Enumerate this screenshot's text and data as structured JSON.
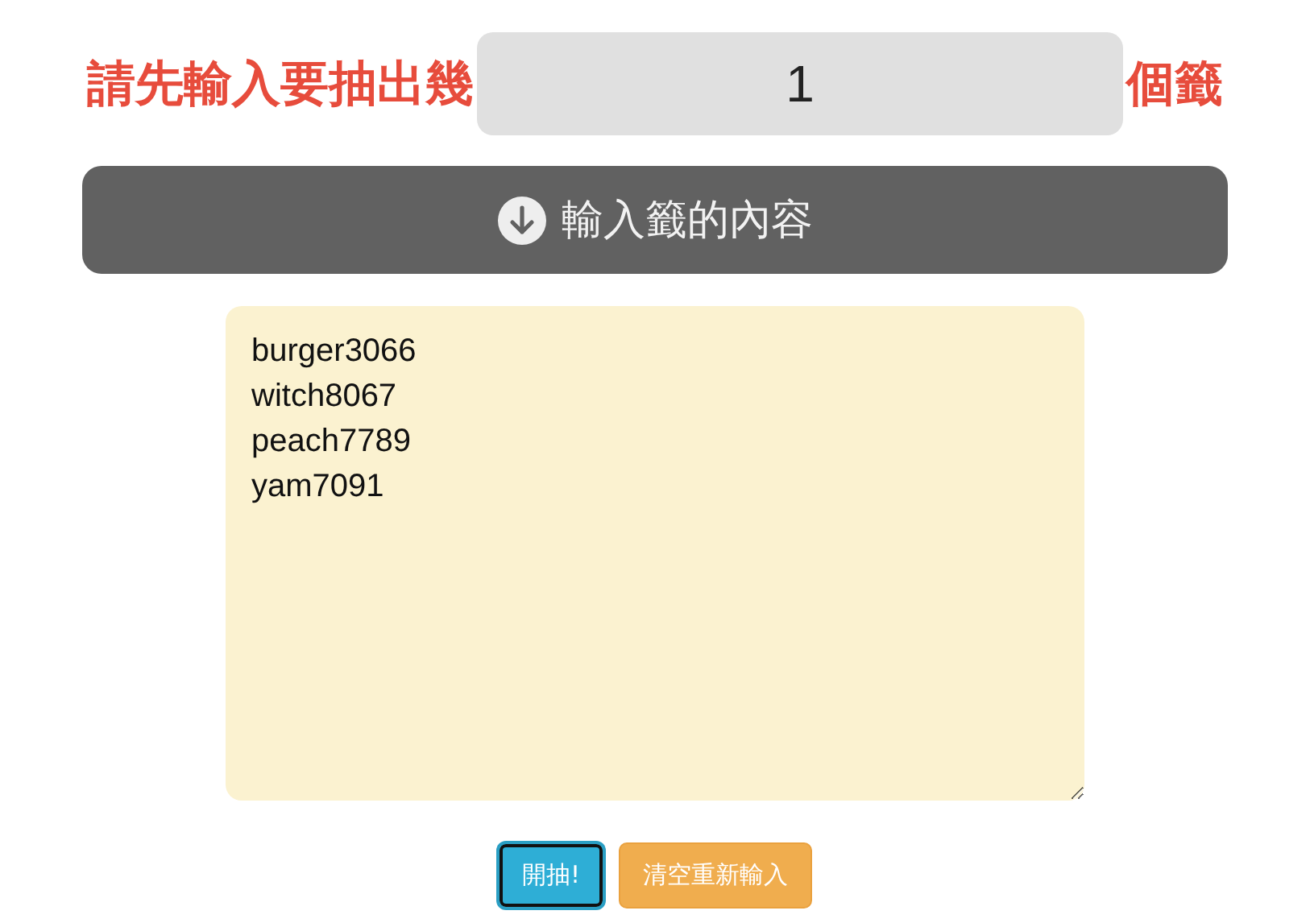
{
  "count_row": {
    "prefix": "請先輸入要抽出幾",
    "value": "1",
    "suffix": "個籤"
  },
  "section_header": {
    "label": "輸入籤的內容"
  },
  "tags_input": {
    "lines": [
      "burger3066",
      "witch8067",
      "peach7789",
      "yam7091"
    ]
  },
  "buttons": [
    {
      "kind": "primary",
      "label": "開抽!",
      "focused": true
    },
    {
      "kind": "warning",
      "label": "清空重新輸入",
      "focused": false
    }
  ]
}
